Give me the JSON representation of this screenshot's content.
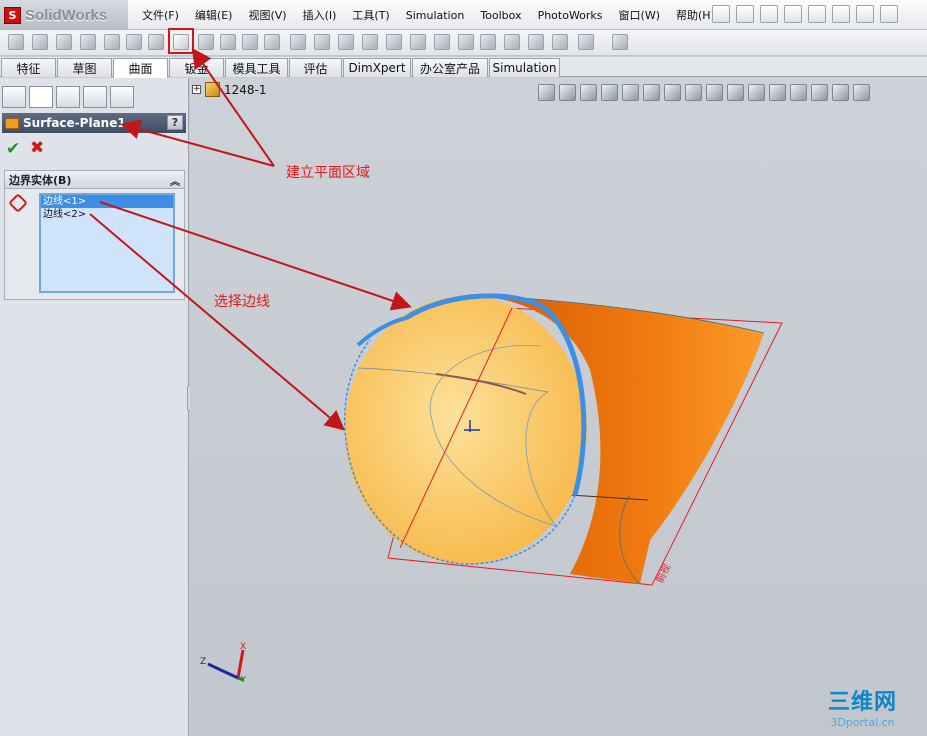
{
  "app": {
    "name": "SolidWorks",
    "logo_mark": "S"
  },
  "menu": [
    "文件(F)",
    "编辑(E)",
    "视图(V)",
    "插入(I)",
    "工具(T)",
    "Simulation",
    "Toolbox",
    "PhotoWorks",
    "窗口(W)",
    "帮助(H)"
  ],
  "tabs": [
    {
      "label": "特征",
      "active": false
    },
    {
      "label": "草图",
      "active": false
    },
    {
      "label": "曲面",
      "active": true
    },
    {
      "label": "钣金",
      "active": false
    },
    {
      "label": "模具工具",
      "active": false
    },
    {
      "label": "评估",
      "active": false
    },
    {
      "label": "DimXpert",
      "active": false
    },
    {
      "label": "办公室产品",
      "active": false
    },
    {
      "label": "Simulation",
      "active": false
    }
  ],
  "property_manager": {
    "title": "Surface-Plane1",
    "help": "?",
    "ok": "✔",
    "cancel": "✖",
    "group_title": "边界实体(B)",
    "collapse": "︽",
    "edges": [
      "边线<1>",
      "边线<2>"
    ]
  },
  "tree": {
    "node": "1248-1",
    "expand": "+"
  },
  "annotations": {
    "planar_region": "建立平面区域",
    "select_edge": "选择边线"
  },
  "watermark": {
    "logo": "三维网",
    "site": "3Dportal.cn"
  },
  "triad": {
    "x": "X",
    "y": "Y",
    "z": "Z"
  },
  "view_label": "前视",
  "colors": {
    "annotation": "#e01a1a",
    "edge_highlight": "#3c8fe6",
    "body_orange": "#f07a10",
    "face_yellow": "#f9c35c"
  }
}
